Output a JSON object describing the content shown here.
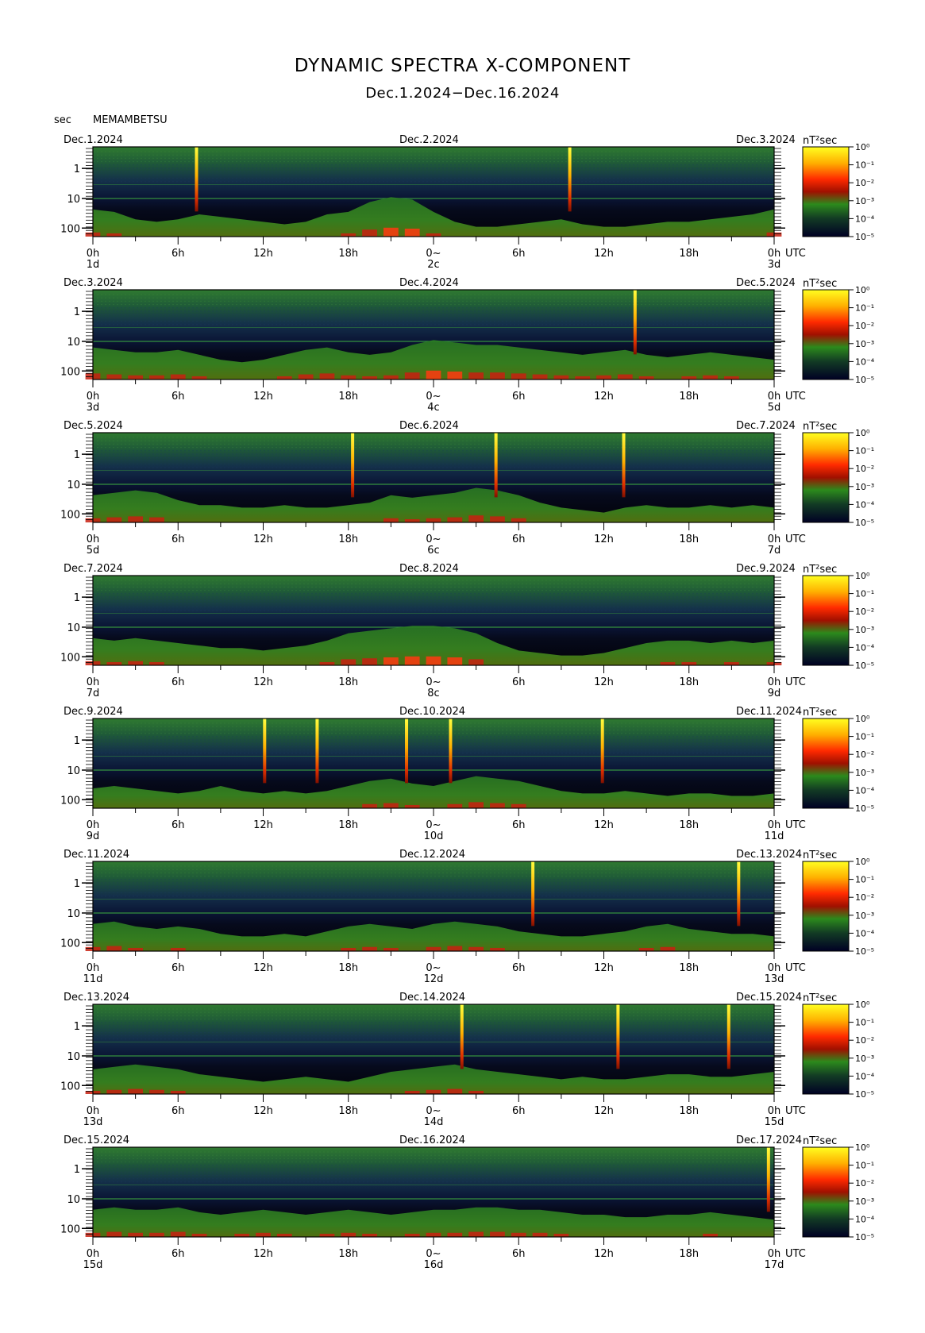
{
  "header": {
    "title": "DYNAMIC SPECTRA X-COMPONENT",
    "subtitle": "Dec.1.2024−Dec.16.2024",
    "y_unit": "sec",
    "station": "MEMAMBETSU"
  },
  "chart_data": {
    "type": "heatmap",
    "ylabel": "sec",
    "yticks": [
      "1",
      "10",
      "100"
    ],
    "xticks": [
      "0h",
      "6h",
      "12h",
      "18h",
      "0~",
      "6h",
      "12h",
      "18h",
      "0h"
    ],
    "x_end_label": "UTC",
    "colorbar": {
      "label": "nT²sec",
      "ticks": [
        "10⁰",
        "10⁻¹",
        "10⁻²",
        "10⁻³",
        "10⁻⁴",
        "10⁻⁵"
      ],
      "colors": [
        "#ffff00",
        "#ffa000",
        "#ff2000",
        "#d01000",
        "#2c8a1c",
        "#10301c",
        "#000020"
      ]
    },
    "panels": [
      {
        "left_date": "Dec.1.2024",
        "mid_date": "Dec.2.2024",
        "right_date": "Dec.3.2024",
        "day_start": "1d",
        "day_mid": "2c",
        "day_end": "3d",
        "spikes": [
          7.3,
          33.6
        ],
        "activity": [
          0.55,
          0.5,
          0.35,
          0.3,
          0.35,
          0.45,
          0.4,
          0.35,
          0.3,
          0.25,
          0.3,
          0.45,
          0.5,
          0.7,
          0.8,
          0.75,
          0.5,
          0.3,
          0.2,
          0.2,
          0.25,
          0.3,
          0.35,
          0.25,
          0.2,
          0.2,
          0.25,
          0.3,
          0.3,
          0.35,
          0.4,
          0.45,
          0.55
        ]
      },
      {
        "left_date": "Dec.3.2024",
        "mid_date": "Dec.4.2024",
        "right_date": "Dec.5.2024",
        "day_start": "3d",
        "day_mid": "4c",
        "day_end": "5d",
        "spikes": [
          38.2
        ],
        "activity": [
          0.65,
          0.6,
          0.55,
          0.55,
          0.6,
          0.5,
          0.4,
          0.35,
          0.4,
          0.5,
          0.6,
          0.65,
          0.55,
          0.5,
          0.55,
          0.7,
          0.8,
          0.75,
          0.7,
          0.7,
          0.65,
          0.6,
          0.55,
          0.5,
          0.55,
          0.6,
          0.5,
          0.45,
          0.5,
          0.55,
          0.5,
          0.45,
          0.4
        ]
      },
      {
        "left_date": "Dec.5.2024",
        "mid_date": "Dec.6.2024",
        "right_date": "Dec.7.2024",
        "day_start": "5d",
        "day_mid": "6c",
        "day_end": "7d",
        "spikes": [
          18.3,
          28.4,
          37.4
        ],
        "activity": [
          0.55,
          0.6,
          0.65,
          0.6,
          0.45,
          0.35,
          0.35,
          0.3,
          0.3,
          0.35,
          0.3,
          0.3,
          0.35,
          0.4,
          0.55,
          0.5,
          0.55,
          0.6,
          0.7,
          0.65,
          0.55,
          0.4,
          0.3,
          0.25,
          0.2,
          0.3,
          0.35,
          0.3,
          0.3,
          0.35,
          0.3,
          0.35,
          0.3
        ]
      },
      {
        "left_date": "Dec.7.2024",
        "mid_date": "Dec.8.2024",
        "right_date": "Dec.9.2024",
        "day_start": "7d",
        "day_mid": "8c",
        "day_end": "9d",
        "spikes": [],
        "activity": [
          0.55,
          0.5,
          0.55,
          0.5,
          0.45,
          0.4,
          0.35,
          0.35,
          0.3,
          0.35,
          0.4,
          0.5,
          0.65,
          0.7,
          0.75,
          0.8,
          0.8,
          0.75,
          0.65,
          0.45,
          0.3,
          0.25,
          0.2,
          0.2,
          0.25,
          0.35,
          0.45,
          0.5,
          0.5,
          0.45,
          0.5,
          0.45,
          0.5
        ]
      },
      {
        "left_date": "Dec.9.2024",
        "mid_date": "Dec.10.2024",
        "right_date": "Dec.11.2024",
        "day_start": "9d",
        "day_mid": "10d",
        "day_end": "11d",
        "spikes": [
          12.1,
          15.8,
          22.1,
          25.2,
          35.9
        ],
        "activity": [
          0.4,
          0.45,
          0.4,
          0.35,
          0.3,
          0.35,
          0.45,
          0.35,
          0.3,
          0.35,
          0.3,
          0.35,
          0.45,
          0.55,
          0.6,
          0.5,
          0.45,
          0.55,
          0.65,
          0.6,
          0.55,
          0.45,
          0.35,
          0.3,
          0.3,
          0.35,
          0.3,
          0.25,
          0.3,
          0.3,
          0.25,
          0.25,
          0.3
        ]
      },
      {
        "left_date": "Dec.11.2024",
        "mid_date": "Dec.12.2024",
        "right_date": "Dec.13.2024",
        "day_start": "11d",
        "day_mid": "12d",
        "day_end": "13d",
        "spikes": [
          31.0,
          45.5
        ],
        "activity": [
          0.55,
          0.6,
          0.5,
          0.45,
          0.5,
          0.45,
          0.35,
          0.3,
          0.3,
          0.35,
          0.3,
          0.4,
          0.5,
          0.55,
          0.5,
          0.45,
          0.55,
          0.6,
          0.55,
          0.5,
          0.4,
          0.35,
          0.3,
          0.3,
          0.35,
          0.4,
          0.5,
          0.55,
          0.45,
          0.4,
          0.35,
          0.35,
          0.3
        ]
      },
      {
        "left_date": "Dec.13.2024",
        "mid_date": "Dec.14.2024",
        "right_date": "Dec.15.2024",
        "day_start": "13d",
        "day_mid": "14d",
        "day_end": "15d",
        "spikes": [
          26.0,
          37.0,
          44.8
        ],
        "activity": [
          0.5,
          0.55,
          0.6,
          0.55,
          0.5,
          0.4,
          0.35,
          0.3,
          0.25,
          0.3,
          0.35,
          0.3,
          0.25,
          0.35,
          0.45,
          0.5,
          0.55,
          0.6,
          0.5,
          0.45,
          0.4,
          0.35,
          0.3,
          0.35,
          0.3,
          0.3,
          0.35,
          0.4,
          0.4,
          0.35,
          0.35,
          0.4,
          0.45
        ]
      },
      {
        "left_date": "Dec.15.2024",
        "mid_date": "Dec.16.2024",
        "right_date": "Dec.17.2024",
        "day_start": "15d",
        "day_mid": "16d",
        "day_end": "17d",
        "spikes": [
          47.6
        ],
        "activity": [
          0.55,
          0.6,
          0.55,
          0.55,
          0.6,
          0.5,
          0.45,
          0.5,
          0.55,
          0.5,
          0.45,
          0.5,
          0.55,
          0.5,
          0.45,
          0.5,
          0.55,
          0.55,
          0.6,
          0.6,
          0.55,
          0.55,
          0.5,
          0.45,
          0.45,
          0.4,
          0.4,
          0.45,
          0.45,
          0.5,
          0.45,
          0.4,
          0.35
        ]
      }
    ]
  }
}
